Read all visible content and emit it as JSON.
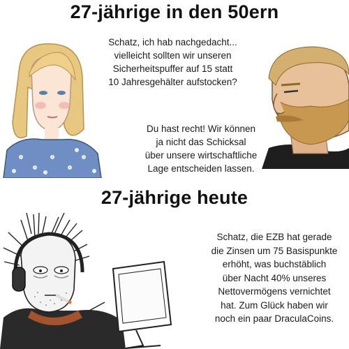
{
  "panel_top": {
    "title": "27-jährige in den 50ern",
    "girl_quote": [
      "Schatz, ich hab nachgedacht...",
      "vielleicht sollten wir unseren",
      "Sicherheitspuffer auf 15 statt",
      "10 Jahresgehälter aufstocken?"
    ],
    "man_quote": [
      "Du hast recht! Wir können",
      "ja nicht das Schicksal",
      "über unsere wirtschaftliche",
      "Lage entscheiden lassen."
    ]
  },
  "panel_bottom": {
    "title": "27-jährige heute",
    "doomer_quote": [
      "Schatz, die EZB hat gerade",
      "die Zinsen um 75 Basispunkte",
      "erhöht, was buchstäblich",
      "über Nacht 40% unseres",
      "Nettovermögens vernichtet",
      "hat. Zum Glück haben wir",
      "noch ein paar DraculaCoins."
    ]
  }
}
